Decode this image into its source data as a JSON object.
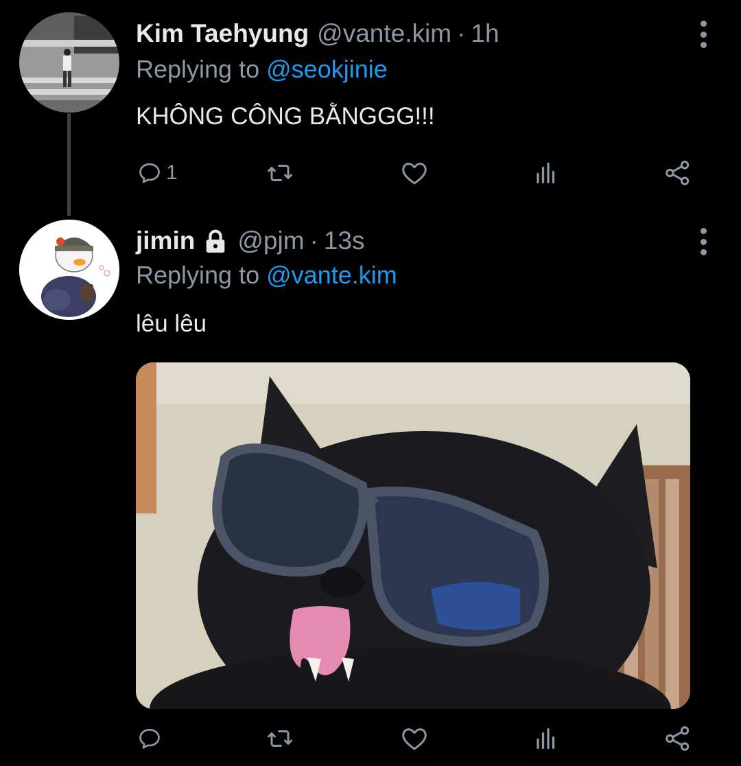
{
  "tweets": [
    {
      "name": "Kim Taehyung",
      "handle": "@vante.kim",
      "time": "1h",
      "replying_prefix": "Replying to",
      "replying_to": "@seokjinie",
      "text": "KHÔNG CÔNG BẰNGGG!!!",
      "reply_count": "1"
    },
    {
      "name": "jimin",
      "handle": "@pjm",
      "time": "13s",
      "replying_prefix": "Replying to",
      "replying_to": "@vante.kim",
      "text": "lêu lêu",
      "reply_count": ""
    }
  ],
  "separator": "·",
  "icons": [
    "more-icon",
    "reply-icon",
    "retweet-icon",
    "like-icon",
    "analytics-icon",
    "share-icon",
    "lock-icon"
  ],
  "colors": {
    "background": "#000000",
    "text": "#e7e9ea",
    "muted": "#8b98a5",
    "link": "#1d9bf0"
  }
}
